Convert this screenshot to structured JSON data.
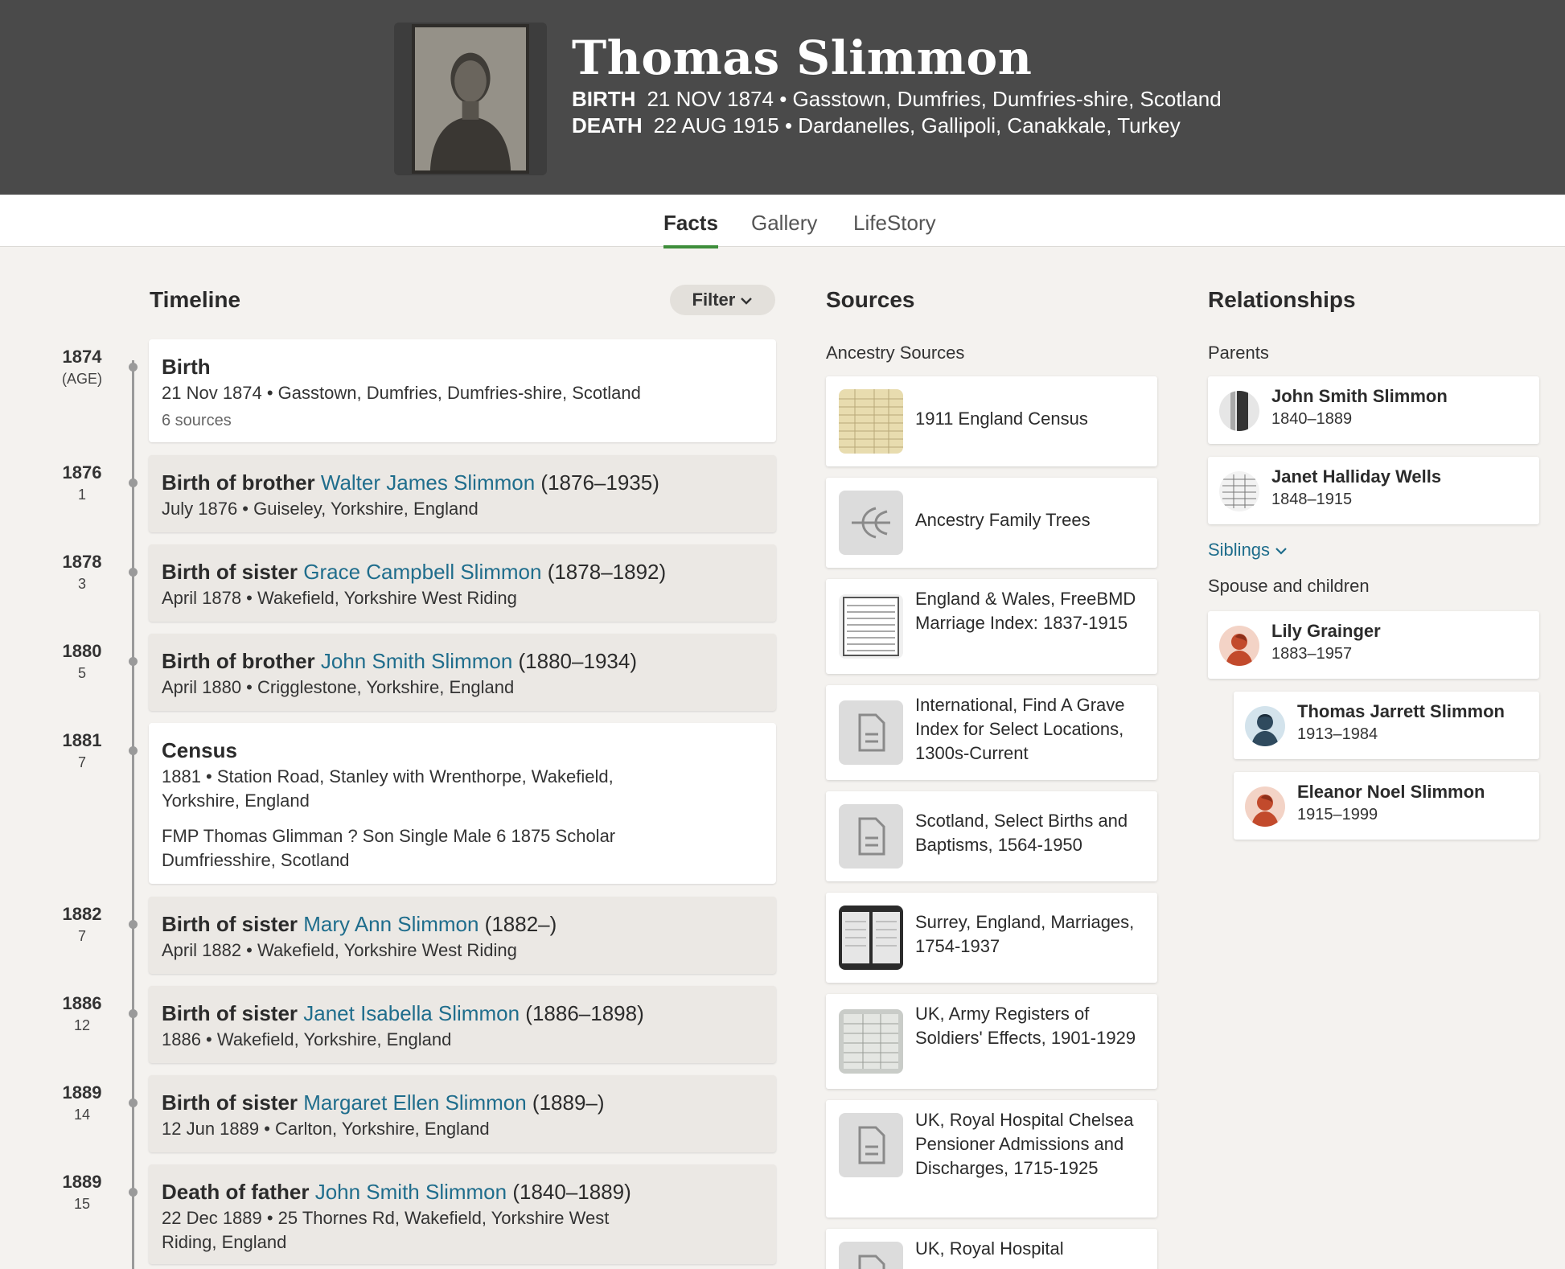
{
  "person": {
    "name": "Thomas Slimmon",
    "birth_label": "BIRTH",
    "birth_value": "21 NOV 1874 • Gasstown, Dumfries, Dumfries-shire, Scotland",
    "death_label": "DEATH",
    "death_value": "22 AUG 1915 • Dardanelles, Gallipoli, Canakkale, Turkey"
  },
  "tabs": [
    {
      "label": "Facts",
      "active": true
    },
    {
      "label": "Gallery",
      "active": false
    },
    {
      "label": "LifeStory",
      "active": false
    }
  ],
  "timeline": {
    "title": "Timeline",
    "filter_label": "Filter",
    "events": [
      {
        "year": "1874",
        "age": "(AGE)",
        "title_bold": "Birth",
        "link": "",
        "dates": "",
        "detail": "21 Nov 1874 • Gasstown, Dumfries, Dumfries-shire, Scotland",
        "extra": "",
        "sources": "6 sources"
      },
      {
        "year": "1876",
        "age": "1",
        "title_bold": "Birth of brother ",
        "link": "Walter James Slimmon",
        "dates": " (1876–1935)",
        "detail": "July 1876 • Guiseley, Yorkshire, England",
        "extra": "",
        "sources": ""
      },
      {
        "year": "1878",
        "age": "3",
        "title_bold": "Birth of sister ",
        "link": "Grace Campbell Slimmon",
        "dates": " (1878–1892)",
        "detail": "April 1878 • Wakefield, Yorkshire West Riding",
        "extra": "",
        "sources": ""
      },
      {
        "year": "1880",
        "age": "5",
        "title_bold": "Birth of brother ",
        "link": "John Smith Slimmon",
        "dates": " (1880–1934)",
        "detail": "April 1880 • Crigglestone, Yorkshire, England",
        "extra": "",
        "sources": ""
      },
      {
        "year": "1881",
        "age": "7",
        "title_bold": "Census",
        "link": "",
        "dates": "",
        "detail": "1881 • Station Road, Stanley with Wrenthorpe, Wakefield, Yorkshire, England",
        "extra": "FMP Thomas Glimman ? Son Single Male 6 1875 Scholar Dumfriesshire, Scotland",
        "sources": ""
      },
      {
        "year": "1882",
        "age": "7",
        "title_bold": "Birth of sister ",
        "link": "Mary Ann Slimmon",
        "dates": " (1882–)",
        "detail": "April 1882 • Wakefield, Yorkshire West Riding",
        "extra": "",
        "sources": ""
      },
      {
        "year": "1886",
        "age": "12",
        "title_bold": "Birth of sister ",
        "link": "Janet Isabella Slimmon",
        "dates": " (1886–1898)",
        "detail": "1886 • Wakefield, Yorkshire, England",
        "extra": "",
        "sources": ""
      },
      {
        "year": "1889",
        "age": "14",
        "title_bold": "Birth of sister ",
        "link": "Margaret Ellen Slimmon",
        "dates": " (1889–)",
        "detail": "12 Jun 1889 • Carlton, Yorkshire, England",
        "extra": "",
        "sources": ""
      },
      {
        "year": "1889",
        "age": "15",
        "title_bold": "Death of father ",
        "link": "John Smith Slimmon",
        "dates": " (1840–1889)",
        "detail": "22 Dec 1889 • 25 Thornes Rd, Wakefield, Yorkshire West Riding, England",
        "extra": "",
        "sources": ""
      }
    ]
  },
  "sources": {
    "title": "Sources",
    "subtitle": "Ancestry Sources",
    "items": [
      {
        "label": "1911 England Census",
        "icon": "census-thumbnail"
      },
      {
        "label": "Ancestry Family Trees",
        "icon": "tree-leaf-icon"
      },
      {
        "label": "England & Wales, FreeBMD Marriage Index: 1837-1915",
        "icon": "index-thumbnail"
      },
      {
        "label": "International, Find A Grave Index for Select Locations, 1300s-Current",
        "icon": "document-icon"
      },
      {
        "label": "Scotland, Select Births and Baptisms, 1564-1950",
        "icon": "document-icon"
      },
      {
        "label": "Surrey, England, Marriages, 1754-1937",
        "icon": "register-thumbnail"
      },
      {
        "label": "UK, Army Registers of Soldiers' Effects, 1901-1929",
        "icon": "ledger-thumbnail"
      },
      {
        "label": "UK, Royal Hospital Chelsea Pensioner Admissions and Discharges, 1715-1925",
        "icon": "document-icon"
      },
      {
        "label": "UK, Royal Hospital",
        "icon": "document-icon"
      }
    ]
  },
  "relationships": {
    "title": "Relationships",
    "parents_label": "Parents",
    "siblings_label": "Siblings",
    "spouse_label": "Spouse and children",
    "parents": [
      {
        "name": "John Smith Slimmon",
        "dates": "1840–1889"
      },
      {
        "name": "Janet Halliday Wells",
        "dates": "1848–1915"
      }
    ],
    "spouse": {
      "name": "Lily Grainger",
      "dates": "1883–1957"
    },
    "children": [
      {
        "name": "Thomas Jarrett Slimmon",
        "dates": "1913–1984"
      },
      {
        "name": "Eleanor Noel Slimmon",
        "dates": "1915–1999"
      }
    ]
  },
  "colors": {
    "header_bg": "#4a4a4a",
    "link": "#1f6d8c",
    "tab_underline": "#3e8e3b"
  }
}
